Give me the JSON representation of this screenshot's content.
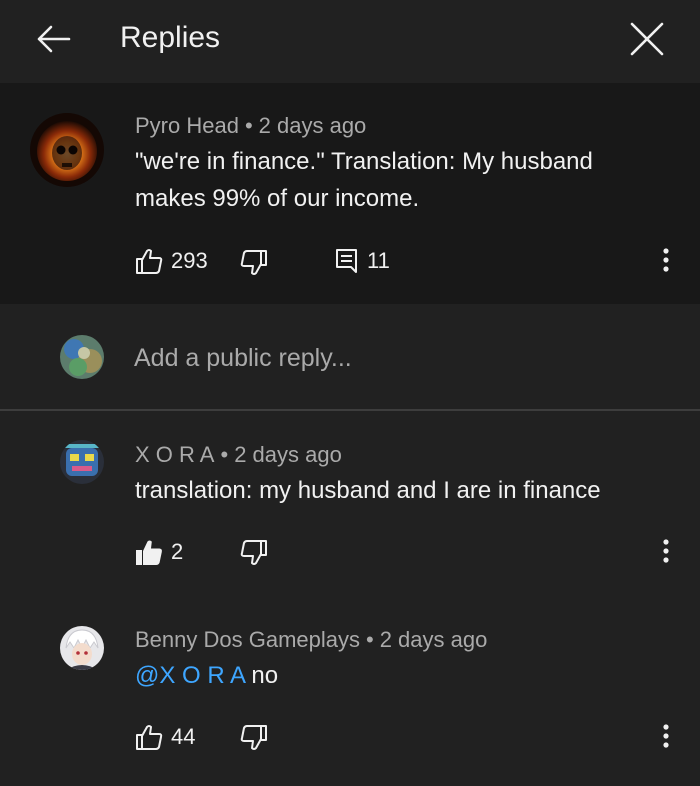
{
  "header": {
    "title": "Replies",
    "back_icon": "arrow-left-icon",
    "close_icon": "close-icon"
  },
  "parent_comment": {
    "author": "Pyro Head",
    "time": "2 days ago",
    "text": "\"we're in finance.\" Translation: My husband makes 99% of our income.",
    "likes": "293",
    "replies": "11"
  },
  "reply_box": {
    "placeholder": "Add a public reply..."
  },
  "replies": [
    {
      "author": "X O R A",
      "time": "2 days ago",
      "text": "translation: my husband and I are in finance",
      "likes": "2",
      "liked": true
    },
    {
      "author": "Benny Dos Gameplays",
      "time": "2 days ago",
      "mention": "@X O R A",
      "text": " no",
      "likes": "44",
      "liked": false
    }
  ],
  "separator": "•",
  "colors": {
    "background": "#212121",
    "parent_background": "#181818",
    "text": "#f1f1f1",
    "secondary_text": "#aaaaaa",
    "mention": "#3ea6ff",
    "divider": "#3d3d3d"
  }
}
